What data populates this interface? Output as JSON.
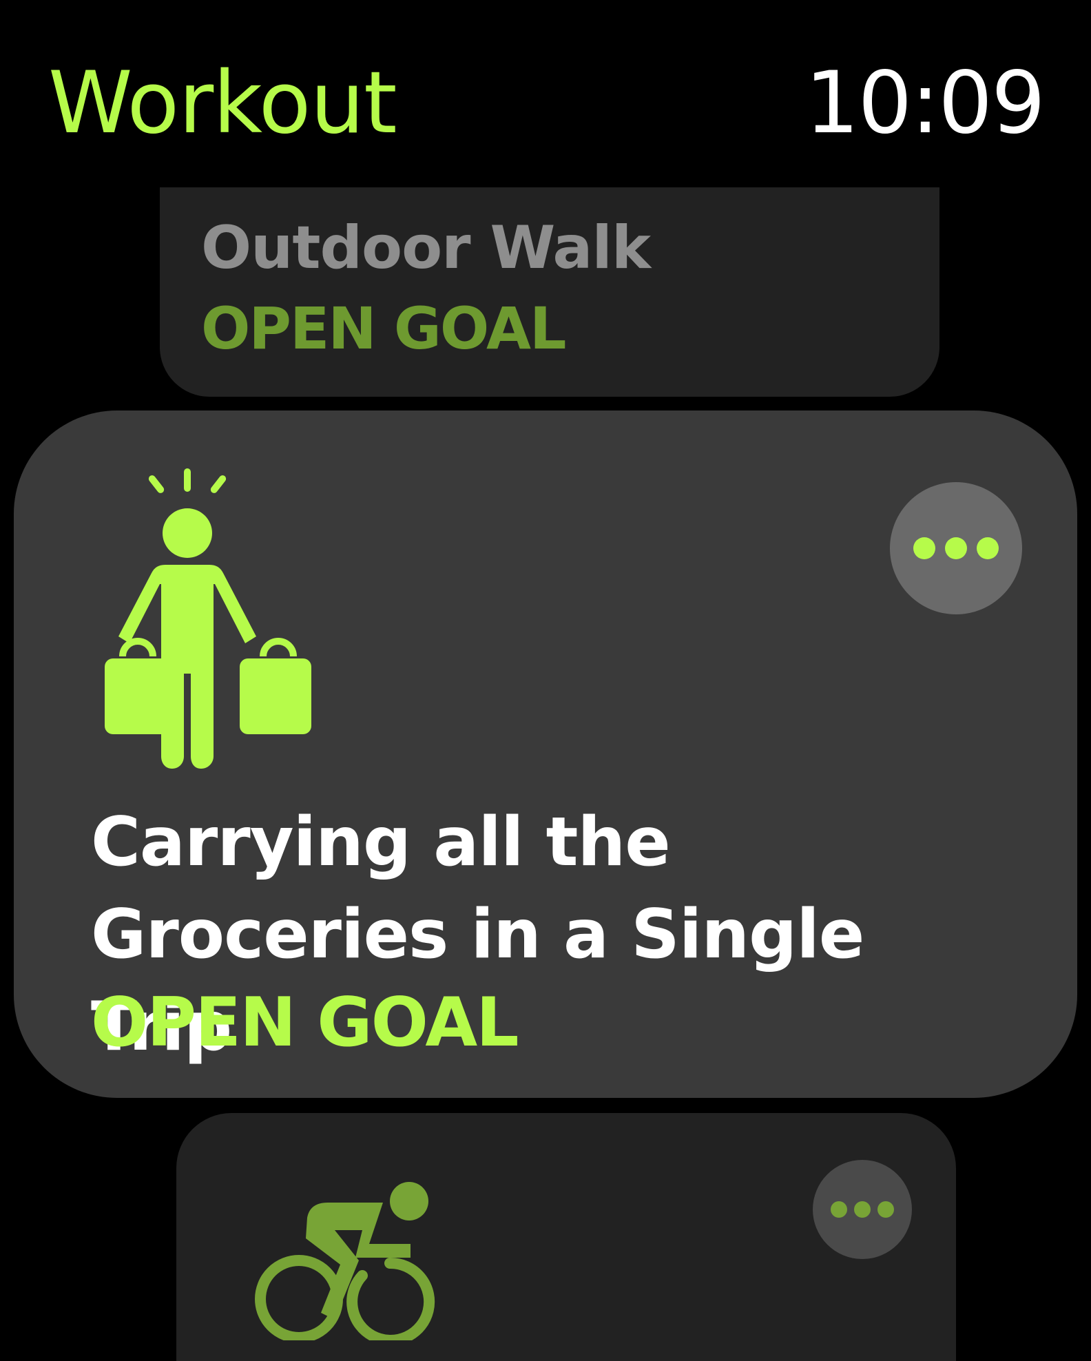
{
  "header": {
    "app_title": "Workout",
    "time": "10:09"
  },
  "workouts": [
    {
      "title": "Outdoor Walk",
      "goal": "OPEN GOAL",
      "icon": "walking-icon",
      "state": "previous"
    },
    {
      "title": "Carrying all the Groceries in a Single Trip",
      "goal": "OPEN GOAL",
      "icon": "person-carrying-bags-icon",
      "more_icon": "ellipsis-icon",
      "state": "focused"
    },
    {
      "title": "",
      "goal": "",
      "icon": "cycling-icon",
      "more_icon": "ellipsis-icon",
      "state": "next"
    }
  ],
  "colors": {
    "accent": "#b6fb4a",
    "accent_dimmed": "#6e9a30",
    "background": "#000000",
    "card_focused": "#3a3a3a",
    "card_unfocused": "#222222",
    "text_primary": "#ffffff",
    "text_dimmed": "#8e8e8e"
  }
}
